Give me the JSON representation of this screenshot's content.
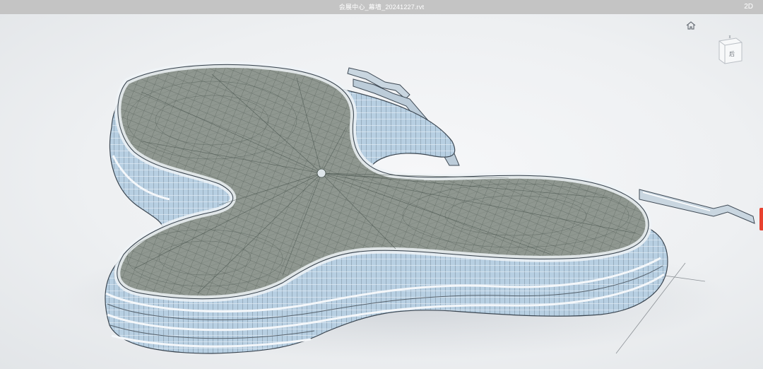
{
  "titlebar": {
    "file_name": "会展中心_幕墙_20241227.rvt",
    "mode_toggle": "2D"
  },
  "viewport": {
    "model": "3d-building-model",
    "cube_face_label": "后"
  },
  "icons": {
    "home": "home-icon",
    "viewcube": "viewcube-icon",
    "side_panel": "side-panel-handle"
  },
  "colors": {
    "titlebar_bg": "#c4c4c4",
    "roof": "#8a9289",
    "glass": "#a9c7e0",
    "frame": "#ffffff",
    "accent": "#e8412f"
  }
}
